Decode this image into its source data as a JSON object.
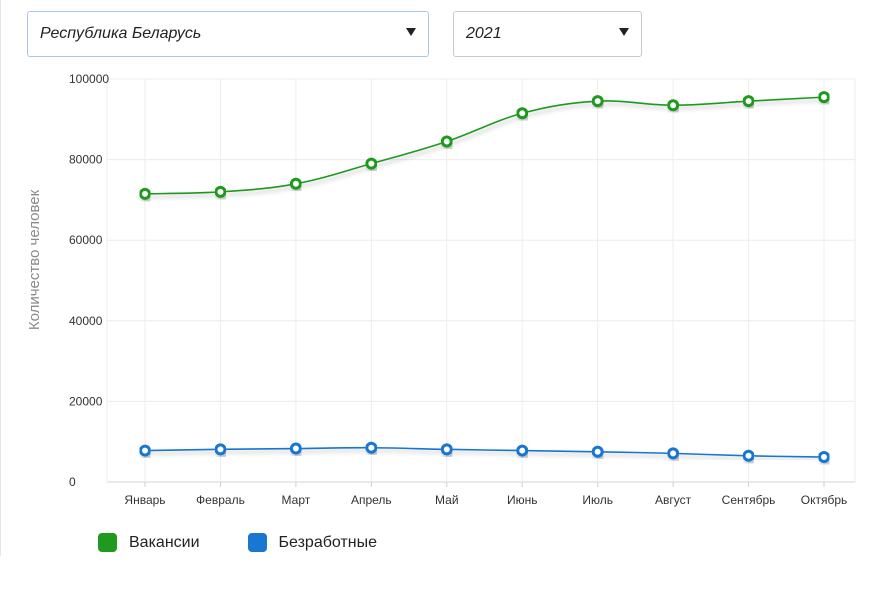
{
  "filters": {
    "country": "Республика Беларусь",
    "year": "2021"
  },
  "chart_data": {
    "type": "line",
    "categories": [
      "Январь",
      "Февраль",
      "Март",
      "Апрель",
      "Май",
      "Июнь",
      "Июль",
      "Август",
      "Сентябрь",
      "Октябрь"
    ],
    "ylabel": "Количество человек",
    "xlabel": "",
    "ylim": [
      0,
      100000
    ],
    "yticks": [
      "0",
      "20000",
      "40000",
      "60000",
      "80000",
      "100000"
    ],
    "grid": true,
    "legend_position": "bottom-left",
    "series": [
      {
        "name": "Вакансии",
        "color": "#1f9a1f",
        "values": [
          71500,
          72000,
          74000,
          79000,
          84500,
          91500,
          94500,
          93500,
          94500,
          95500
        ]
      },
      {
        "name": "Безработные",
        "color": "#1976d2",
        "values": [
          7800,
          8100,
          8300,
          8500,
          8100,
          7800,
          7500,
          7100,
          6500,
          6200
        ]
      }
    ]
  }
}
